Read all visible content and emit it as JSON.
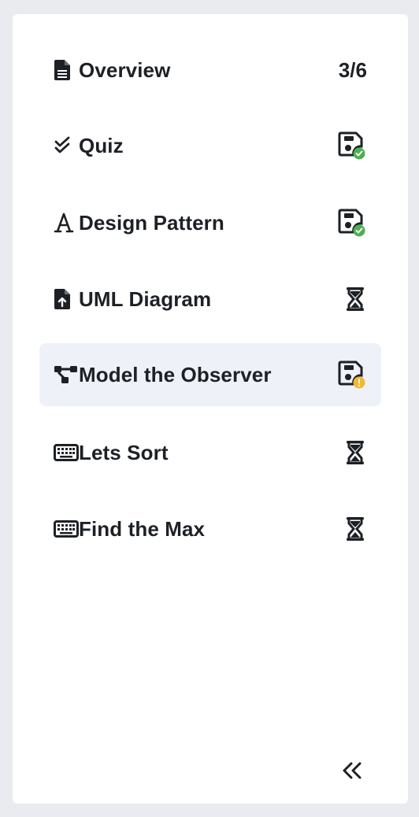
{
  "sidebar": {
    "items": [
      {
        "label": "Overview",
        "icon": "file-text-icon",
        "status_text": "3/6"
      },
      {
        "label": "Quiz",
        "icon": "double-check-icon",
        "status_icon": "saved-success-icon",
        "badge_color": "#4caf50"
      },
      {
        "label": "Design Pattern",
        "icon": "font-icon",
        "status_icon": "saved-success-icon",
        "badge_color": "#4caf50"
      },
      {
        "label": "UML Diagram",
        "icon": "file-upload-icon",
        "status_icon": "hourglass-icon"
      },
      {
        "label": "Model the Observer",
        "icon": "diagram-project-icon",
        "status_icon": "saved-warning-icon",
        "badge_color": "#f2b82e",
        "active": true
      },
      {
        "label": "Lets Sort",
        "icon": "keyboard-icon",
        "status_icon": "hourglass-icon"
      },
      {
        "label": "Find the Max",
        "icon": "keyboard-icon",
        "status_icon": "hourglass-icon"
      }
    ],
    "collapse_icon": "double-chevron-left-icon"
  },
  "colors": {
    "background": "#e9ebef",
    "panel": "#ffffff",
    "active_row": "#eef2f8",
    "text": "#1d2126",
    "success": "#4caf50",
    "warning": "#f2b82e"
  }
}
